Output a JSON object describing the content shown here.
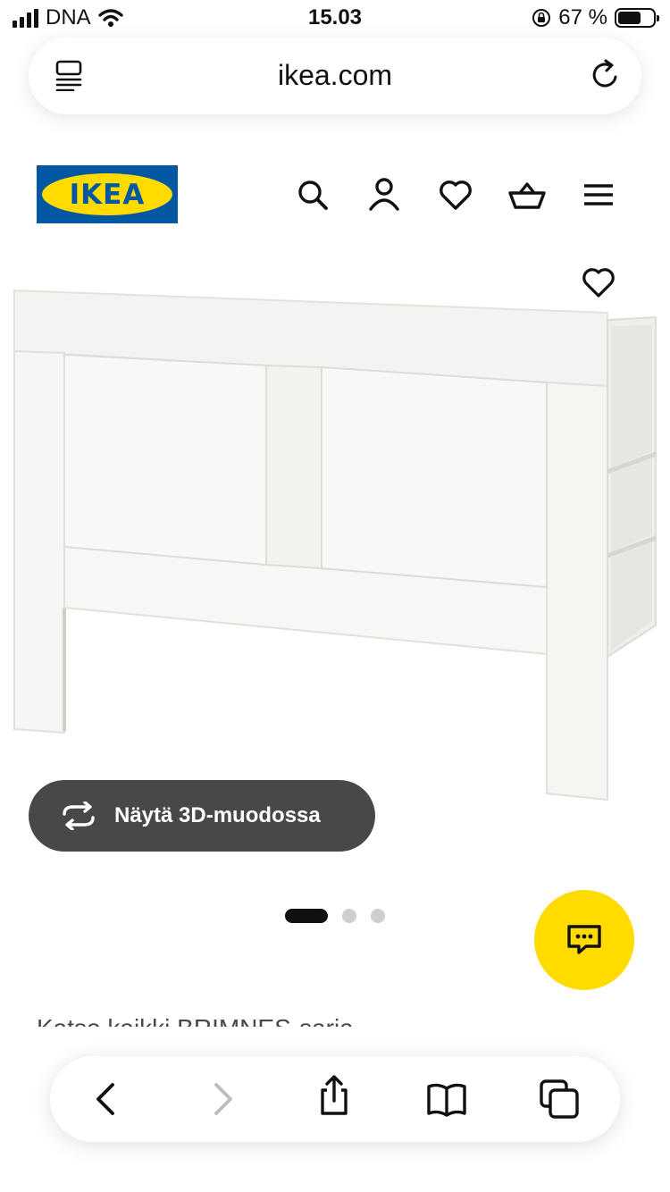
{
  "status_bar": {
    "carrier": "DNA",
    "time": "15.03",
    "battery_percent": "67 %",
    "battery_level": 0.67
  },
  "browser": {
    "url": "ikea.com",
    "reader_icon": "reader-view-icon",
    "reload_icon": "reload-icon"
  },
  "header": {
    "logo_text": "IKEA",
    "icons": [
      "search-icon",
      "account-icon",
      "favourites-icon",
      "shopping-basket-icon",
      "menu-icon"
    ]
  },
  "product": {
    "view_3d_label": "Näytä 3D-muodossa",
    "image_count": 3,
    "active_image": 1,
    "series_link": "Katso kaikki BRIMNES-sarja"
  },
  "colors": {
    "ikea_blue": "#0058a3",
    "ikea_yellow": "#ffdb00",
    "button_dark": "#484848"
  }
}
